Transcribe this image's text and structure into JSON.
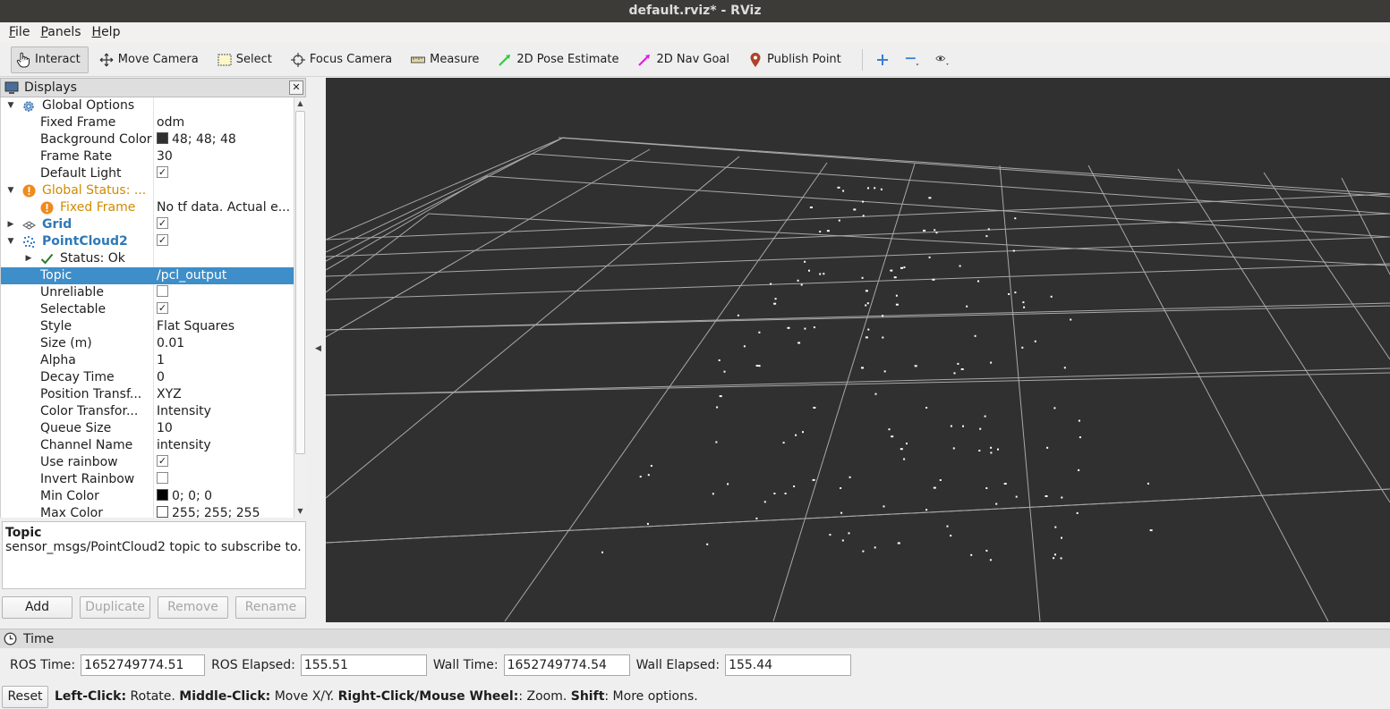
{
  "window": {
    "title": "default.rviz* - RViz"
  },
  "menu": [
    {
      "label": "File",
      "mnemonic": "F",
      "rest": "ile"
    },
    {
      "label": "Panels",
      "mnemonic": "P",
      "rest": "anels"
    },
    {
      "label": "Help",
      "mnemonic": "H",
      "rest": "elp"
    }
  ],
  "toolbar": {
    "interact": "Interact",
    "move_camera": "Move Camera",
    "select": "Select",
    "focus_camera": "Focus Camera",
    "measure": "Measure",
    "pose_estimate": "2D Pose Estimate",
    "nav_goal": "2D Nav Goal",
    "publish_point": "Publish Point"
  },
  "displays": {
    "title": "Displays",
    "rows": [
      {
        "label": "Global Options",
        "value": ""
      },
      {
        "label": "Fixed Frame",
        "value": "odm"
      },
      {
        "label": "Background Color",
        "value": "48; 48; 48"
      },
      {
        "label": "Frame Rate",
        "value": "30"
      },
      {
        "label": "Default Light",
        "value": ""
      },
      {
        "label": "Global Status: ...",
        "value": ""
      },
      {
        "label": "Fixed Frame",
        "value": "No tf data.  Actual e..."
      },
      {
        "label": "Grid",
        "value": ""
      },
      {
        "label": "PointCloud2",
        "value": ""
      },
      {
        "label": "Status: Ok",
        "value": ""
      },
      {
        "label": "Topic",
        "value": "/pcl_output"
      },
      {
        "label": "Unreliable",
        "value": ""
      },
      {
        "label": "Selectable",
        "value": ""
      },
      {
        "label": "Style",
        "value": "Flat Squares"
      },
      {
        "label": "Size (m)",
        "value": "0.01"
      },
      {
        "label": "Alpha",
        "value": "1"
      },
      {
        "label": "Decay Time",
        "value": "0"
      },
      {
        "label": "Position Transf...",
        "value": "XYZ"
      },
      {
        "label": "Color Transfor...",
        "value": "Intensity"
      },
      {
        "label": "Queue Size",
        "value": "10"
      },
      {
        "label": "Channel Name",
        "value": "intensity"
      },
      {
        "label": "Use rainbow",
        "value": ""
      },
      {
        "label": "Invert Rainbow",
        "value": ""
      },
      {
        "label": "Min Color",
        "value": "0; 0; 0"
      },
      {
        "label": "Max Color",
        "value": "255; 255; 255"
      }
    ],
    "description": {
      "title": "Topic",
      "text": "sensor_msgs/PointCloud2 topic to subscribe to."
    },
    "buttons": {
      "add": "Add",
      "duplicate": "Duplicate",
      "remove": "Remove",
      "rename": "Rename"
    }
  },
  "colors": {
    "background": "#303030",
    "min_color": "#000000",
    "max_color": "#ffffff",
    "selection": "#3d8ec9"
  },
  "time": {
    "title": "Time",
    "ros_time_label": "ROS Time:",
    "ros_time": "1652749774.51",
    "ros_elapsed_label": "ROS Elapsed:",
    "ros_elapsed": "155.51",
    "wall_time_label": "Wall Time:",
    "wall_time": "1652749774.54",
    "wall_elapsed_label": "Wall Elapsed:",
    "wall_elapsed": "155.44"
  },
  "status": {
    "reset": "Reset",
    "b1": "Left-Click:",
    "t1": " Rotate. ",
    "b2": "Middle-Click:",
    "t2": " Move X/Y. ",
    "b3": "Right-Click/Mouse Wheel:",
    "t3": ": Zoom. ",
    "b4": "Shift",
    "t4": ": More options."
  }
}
